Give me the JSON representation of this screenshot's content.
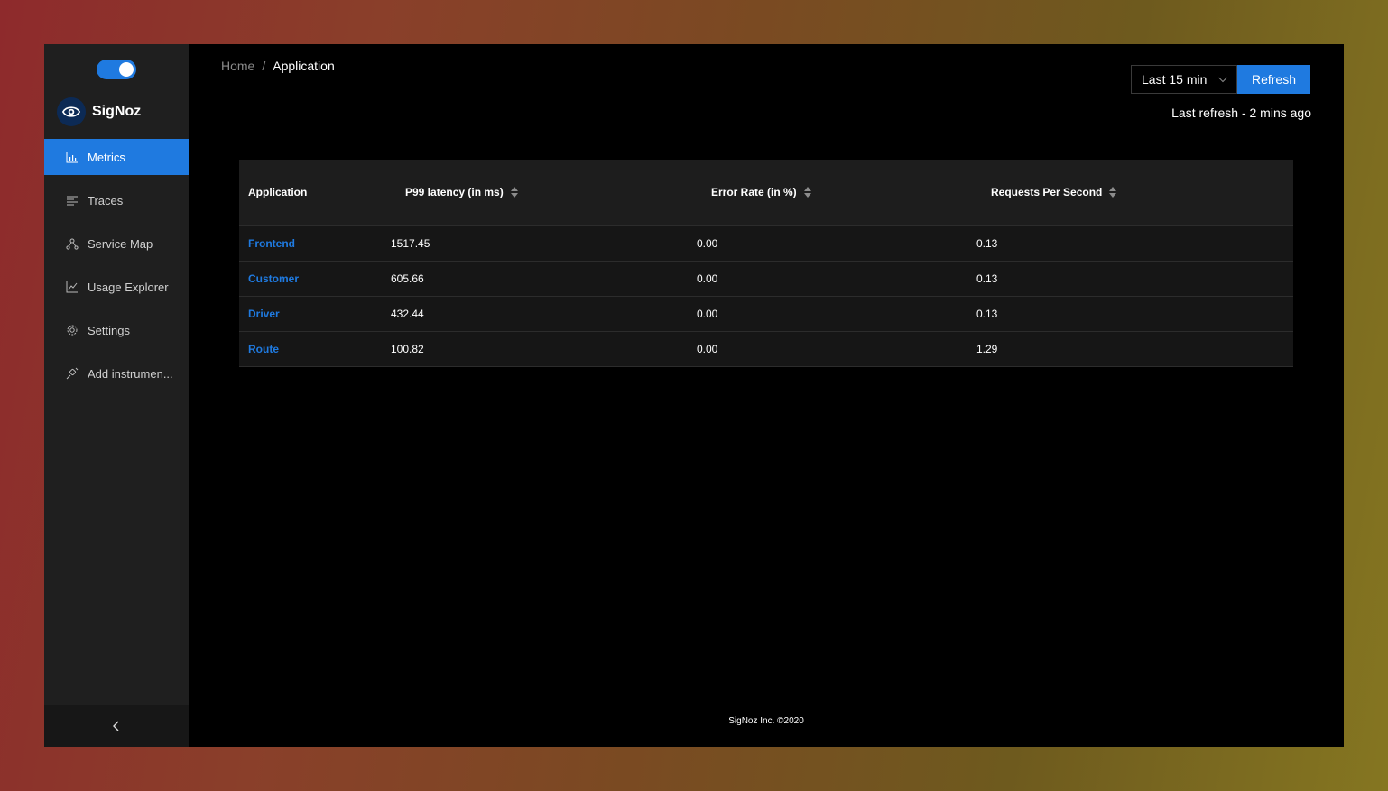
{
  "sidebar": {
    "brand": "SigNoz",
    "items": [
      {
        "label": "Metrics",
        "icon": "bar-chart-icon",
        "active": true
      },
      {
        "label": "Traces",
        "icon": "align-left-icon",
        "active": false
      },
      {
        "label": "Service Map",
        "icon": "deployment-unit-icon",
        "active": false
      },
      {
        "label": "Usage Explorer",
        "icon": "line-chart-icon",
        "active": false
      },
      {
        "label": "Settings",
        "icon": "gear-icon",
        "active": false
      },
      {
        "label": "Add instrumen...",
        "icon": "api-icon",
        "active": false
      }
    ],
    "collapse_glyph": "<"
  },
  "breadcrumb": {
    "home": "Home",
    "separator": "/",
    "current": "Application"
  },
  "controls": {
    "time_range": "Last 15 min",
    "refresh_label": "Refresh",
    "last_refresh": "Last refresh - 2 mins ago"
  },
  "table": {
    "columns": [
      "Application",
      "P99 latency (in ms)",
      "Error Rate (in %)",
      "Requests Per Second"
    ],
    "rows": [
      {
        "application": "Frontend",
        "p99": "1517.45",
        "error_rate": "0.00",
        "rps": "0.13"
      },
      {
        "application": "Customer",
        "p99": "605.66",
        "error_rate": "0.00",
        "rps": "0.13"
      },
      {
        "application": "Driver",
        "p99": "432.44",
        "error_rate": "0.00",
        "rps": "0.13"
      },
      {
        "application": "Route",
        "p99": "100.82",
        "error_rate": "0.00",
        "rps": "1.29"
      }
    ]
  },
  "footer": "SigNoz Inc. ©2020",
  "colors": {
    "accent": "#1f7ae0",
    "sidebar_bg": "#1f1f1f",
    "main_bg": "#000000"
  }
}
